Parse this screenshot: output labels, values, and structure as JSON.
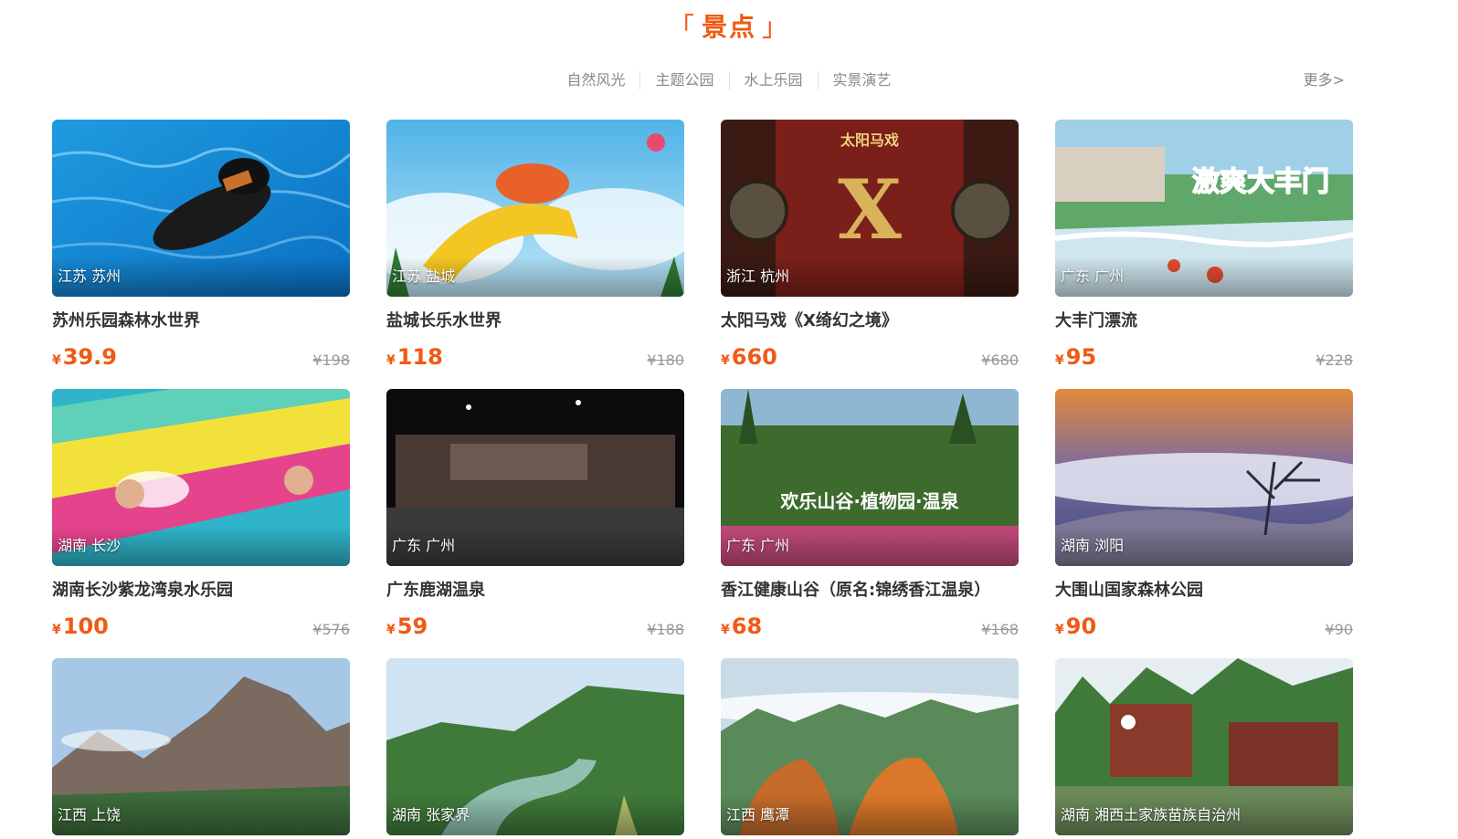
{
  "header": {
    "title": "景点",
    "bracket_open": "「",
    "bracket_close": "」"
  },
  "tabs": [
    {
      "label": "自然风光"
    },
    {
      "label": "主题公园"
    },
    {
      "label": "水上乐园"
    },
    {
      "label": "实景演艺"
    }
  ],
  "more_label": "更多>",
  "currency": "¥",
  "cards": [
    {
      "location": "江苏 苏州",
      "name": "苏州乐园森林水世界",
      "price": "39.9",
      "original": "¥198",
      "scene": "water-pool"
    },
    {
      "location": "江苏 盐城",
      "name": "盐城长乐水世界",
      "price": "118",
      "original": "¥180",
      "scene": "water-park"
    },
    {
      "location": "浙江 杭州",
      "name": "太阳马戏《X绮幻之境》",
      "price": "660",
      "original": "¥680",
      "scene": "circus",
      "poster_text": "太阳马戏"
    },
    {
      "location": "广东 广州",
      "name": "大丰门漂流",
      "price": "95",
      "original": "¥228",
      "scene": "rafting",
      "poster_text": "激爽大丰门"
    },
    {
      "location": "湖南 长沙",
      "name": "湖南长沙紫龙湾泉水乐园",
      "price": "100",
      "original": "¥576",
      "scene": "slide"
    },
    {
      "location": "广东 广州",
      "name": "广东鹿湖温泉",
      "price": "59",
      "original": "¥188",
      "scene": "night"
    },
    {
      "location": "广东 广州",
      "name": "香江健康山谷（原名:锦绣香江温泉）",
      "price": "68",
      "original": "¥168",
      "scene": "garden",
      "poster_text": "欢乐山谷·植物园·温泉"
    },
    {
      "location": "湖南 浏阳",
      "name": "大围山国家森林公园",
      "price": "90",
      "original": "¥90",
      "scene": "clouds"
    },
    {
      "location": "江西 上饶",
      "name": "",
      "price": "",
      "original": "",
      "scene": "mountain"
    },
    {
      "location": "湖南 张家界",
      "name": "",
      "price": "",
      "original": "",
      "scene": "valley"
    },
    {
      "location": "江西 鹰潭",
      "name": "",
      "price": "",
      "original": "",
      "scene": "danxia"
    },
    {
      "location": "湖南 湘西土家族苗族自治州",
      "name": "",
      "price": "",
      "original": "",
      "scene": "rocks"
    }
  ],
  "colors": {
    "accent": "#f05a14",
    "muted": "#999999"
  }
}
